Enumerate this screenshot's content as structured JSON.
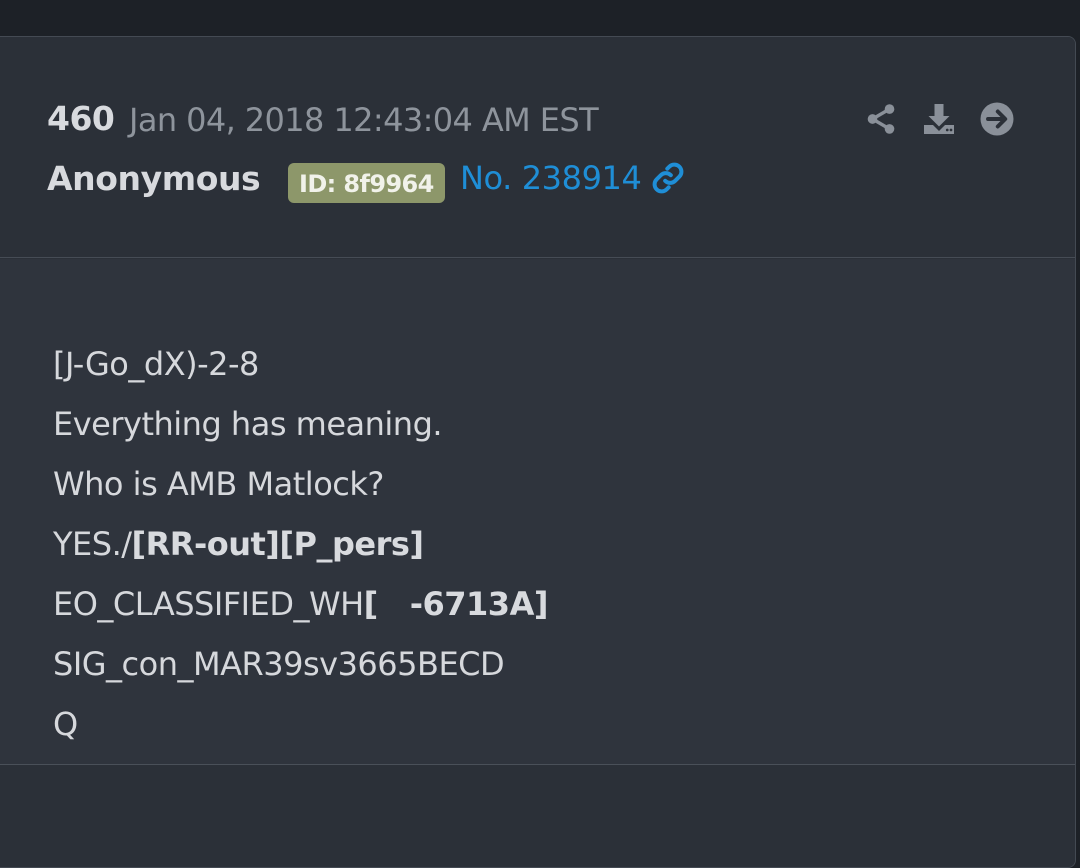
{
  "post": {
    "number": "460",
    "timestamp": "Jan 04, 2018 12:43:04 AM EST",
    "author": "Anonymous",
    "id_badge": "ID: 8f9964",
    "post_link": "No. 238914",
    "badge_color": "#8d976a",
    "link_color": "#1f8ed6"
  },
  "actions": {
    "share_icon": "share-icon",
    "download_icon": "download-icon",
    "next_icon": "arrow-right-circle-icon"
  },
  "message": {
    "line1": "[J-Go_dX)-2-8",
    "line2": "Everything has meaning.",
    "line3": "Who is AMB Matlock?",
    "line4_plain": "YES./",
    "line4_bold": "[RR-out][P_pers]",
    "line5_plain": "EO_CLASSIFIED_WH",
    "line5_bold": "[   -6713A]",
    "line6": "SIG_con_MAR39sv3665BECD",
    "line7": "Q"
  }
}
